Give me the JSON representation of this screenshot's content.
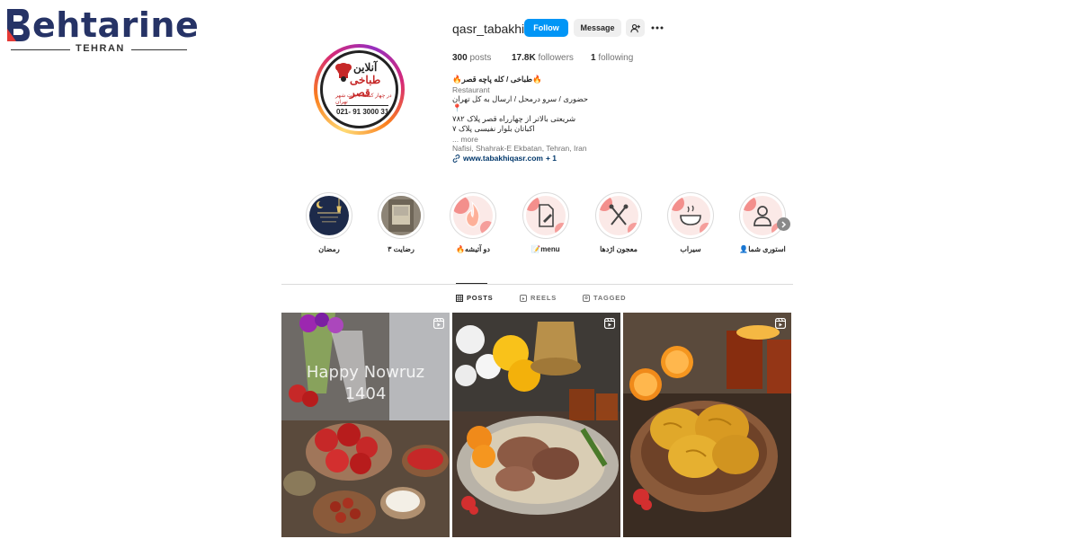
{
  "watermark": {
    "brand": "ehtarine",
    "city": "TEHRAN"
  },
  "profile": {
    "username": "qasr_tabakhi",
    "avatar": {
      "line1": "آنلاین",
      "line2": "طباخی قصر",
      "line3": "در چهار کشته / جنت شهر تهران",
      "phone": "021- 91 3000 31"
    },
    "follow_label": "Follow",
    "message_label": "Message",
    "suggest_icon": "person-add-icon",
    "more_icon": "more-dots-icon",
    "stats": [
      {
        "count": "300",
        "label": "posts"
      },
      {
        "count": "17.8K",
        "label": "followers"
      },
      {
        "count": "1",
        "label": "following"
      }
    ],
    "bio": {
      "name": "🔥طباخی / کله پاچه قصر🔥",
      "category": "Restaurant",
      "line1": "حضوری / سرو درمحل / ارسال به کل تهران",
      "pin": "📍",
      "line2": "شریعتی بالاتر از چهارراه قصر پلاک ۷۸۲",
      "line3": "اکباتان بلوار نفیسی پلاک ۷",
      "more": "... more",
      "location": "Nafisi, Shahrak-E Ekbatan, Tehran, Iran",
      "link": "www.tabakhiqasr.com",
      "link_extra": "+ 1"
    }
  },
  "highlights": [
    {
      "label": "رمضان",
      "style": "ramadan"
    },
    {
      "label": "رضایت ۳",
      "style": "photo"
    },
    {
      "label": "🔥دو آتیشه",
      "style": "fire"
    },
    {
      "label": "📝menu",
      "style": "menu"
    },
    {
      "label": "معجون اژدها",
      "style": "utensils"
    },
    {
      "label": "سیراب",
      "style": "bowl"
    },
    {
      "label": "👤استوری شما",
      "style": "person"
    }
  ],
  "tabs": [
    {
      "label": "POSTS",
      "icon": "grid-icon",
      "active": true
    },
    {
      "label": "REELS",
      "icon": "reels-icon",
      "active": false
    },
    {
      "label": "TAGGED",
      "icon": "tagged-icon",
      "active": false
    }
  ],
  "posts": [
    {
      "type": "reel",
      "overlay_line1": "Happy Nowruz",
      "overlay_line2": "1404"
    },
    {
      "type": "reel"
    },
    {
      "type": "reel"
    }
  ],
  "colors": {
    "accent": "#0095f6",
    "text": "#262626",
    "muted": "#737373",
    "link": "#00376b"
  }
}
